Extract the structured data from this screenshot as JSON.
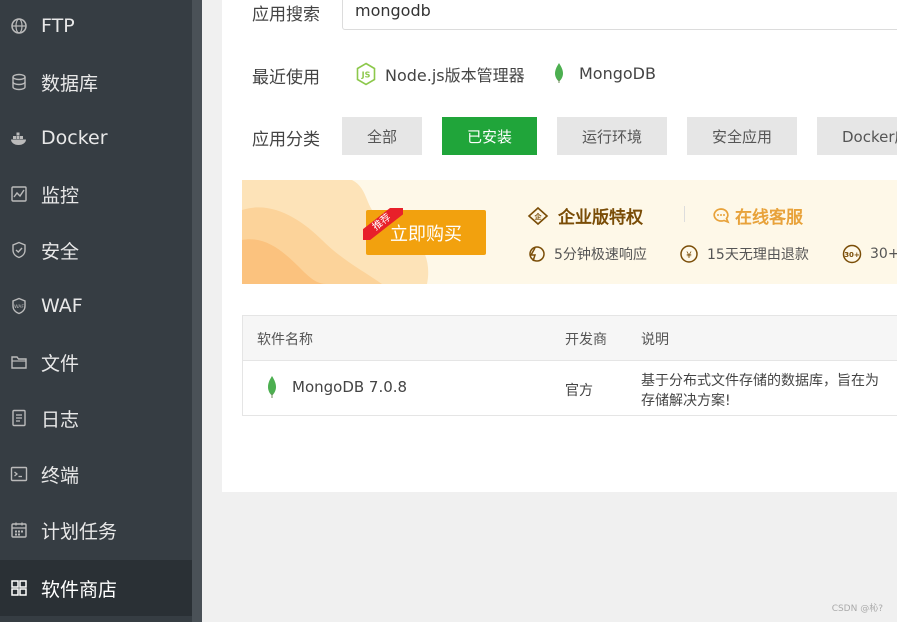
{
  "sidebar": {
    "items": [
      {
        "label": "FTP",
        "icon": "globe-icon"
      },
      {
        "label": "数据库",
        "icon": "database-icon"
      },
      {
        "label": "Docker",
        "icon": "docker-icon"
      },
      {
        "label": "监控",
        "icon": "monitor-icon"
      },
      {
        "label": "安全",
        "icon": "shield-icon"
      },
      {
        "label": "WAF",
        "icon": "waf-shield-icon"
      },
      {
        "label": "文件",
        "icon": "folder-icon"
      },
      {
        "label": "日志",
        "icon": "log-icon"
      },
      {
        "label": "终端",
        "icon": "terminal-icon"
      },
      {
        "label": "计划任务",
        "icon": "calendar-icon"
      },
      {
        "label": "软件商店",
        "icon": "grid-icon",
        "active": true
      }
    ]
  },
  "search": {
    "label": "应用搜索",
    "value": "mongodb"
  },
  "recent": {
    "label": "最近使用",
    "items": [
      {
        "label": "Node.js版本管理器",
        "icon": "nodejs-icon"
      },
      {
        "label": "MongoDB",
        "icon": "mongodb-leaf-icon"
      }
    ]
  },
  "categories": {
    "label": "应用分类",
    "items": [
      {
        "label": "全部"
      },
      {
        "label": "已安装",
        "active": true
      },
      {
        "label": "运行环境"
      },
      {
        "label": "安全应用"
      },
      {
        "label": "Docker应"
      }
    ]
  },
  "banner": {
    "buy_label": "立即购买",
    "tag": "推荐",
    "enterprise": "企业版特权",
    "service": "在线客服",
    "features": [
      "5分钟极速响应",
      "15天无理由退款",
      "30+"
    ]
  },
  "table": {
    "headers": [
      "软件名称",
      "开发商",
      "说明"
    ],
    "rows": [
      {
        "name": "MongoDB 7.0.8",
        "developer": "官方",
        "desc_line1": "基于分布式文件存储的数据库，旨在为",
        "desc_line2": "存储解决方案!"
      }
    ]
  },
  "watermark": "CSDN @杺?",
  "colors": {
    "accent": "#20a53a",
    "sidebar": "#363d43",
    "buy": "#f2a10e"
  }
}
